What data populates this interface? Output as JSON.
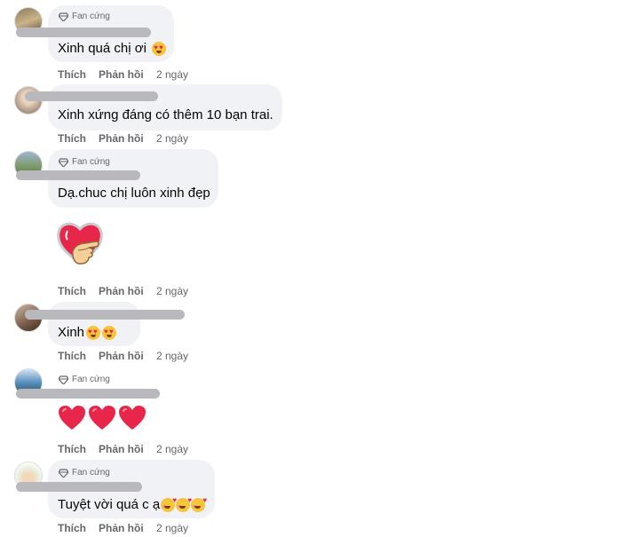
{
  "badge_label": "Fan cứng",
  "action_like": "Thích",
  "action_reply": "Phản hồi",
  "colors": {
    "bubble": "#f0f2f5",
    "meta": "#65676b",
    "redaction": "#b8b8bd",
    "heart": "#e8264a"
  },
  "comments": [
    {
      "has_badge": true,
      "text": "Xinh quá chị ơi",
      "emojis": [
        "heart-eyes-emoji"
      ],
      "time": "2 ngày"
    },
    {
      "has_badge": false,
      "text": "Xinh xứng đáng có thêm 10 bạn trai.",
      "time": "2 ngày"
    },
    {
      "has_badge": true,
      "text": "Dạ.chuc chị luôn xinh đẹp",
      "sticker": "heart-finger-sticker",
      "time": "2 ngày"
    },
    {
      "has_badge": false,
      "text": "Xinh",
      "emojis": [
        "heart-eyes-emoji",
        "heart-eyes-emoji"
      ],
      "time": "2 ngày"
    },
    {
      "has_badge": true,
      "text": "",
      "emojis": [
        "red-heart-emoji",
        "red-heart-emoji",
        "red-heart-emoji"
      ],
      "time": "2 ngày"
    },
    {
      "has_badge": true,
      "text": "Tuyệt vời quá c ạ",
      "emojis": [
        "smiling-hearts-emoji",
        "smiling-hearts-emoji",
        "smiling-hearts-emoji"
      ],
      "time": "2 ngày"
    }
  ]
}
